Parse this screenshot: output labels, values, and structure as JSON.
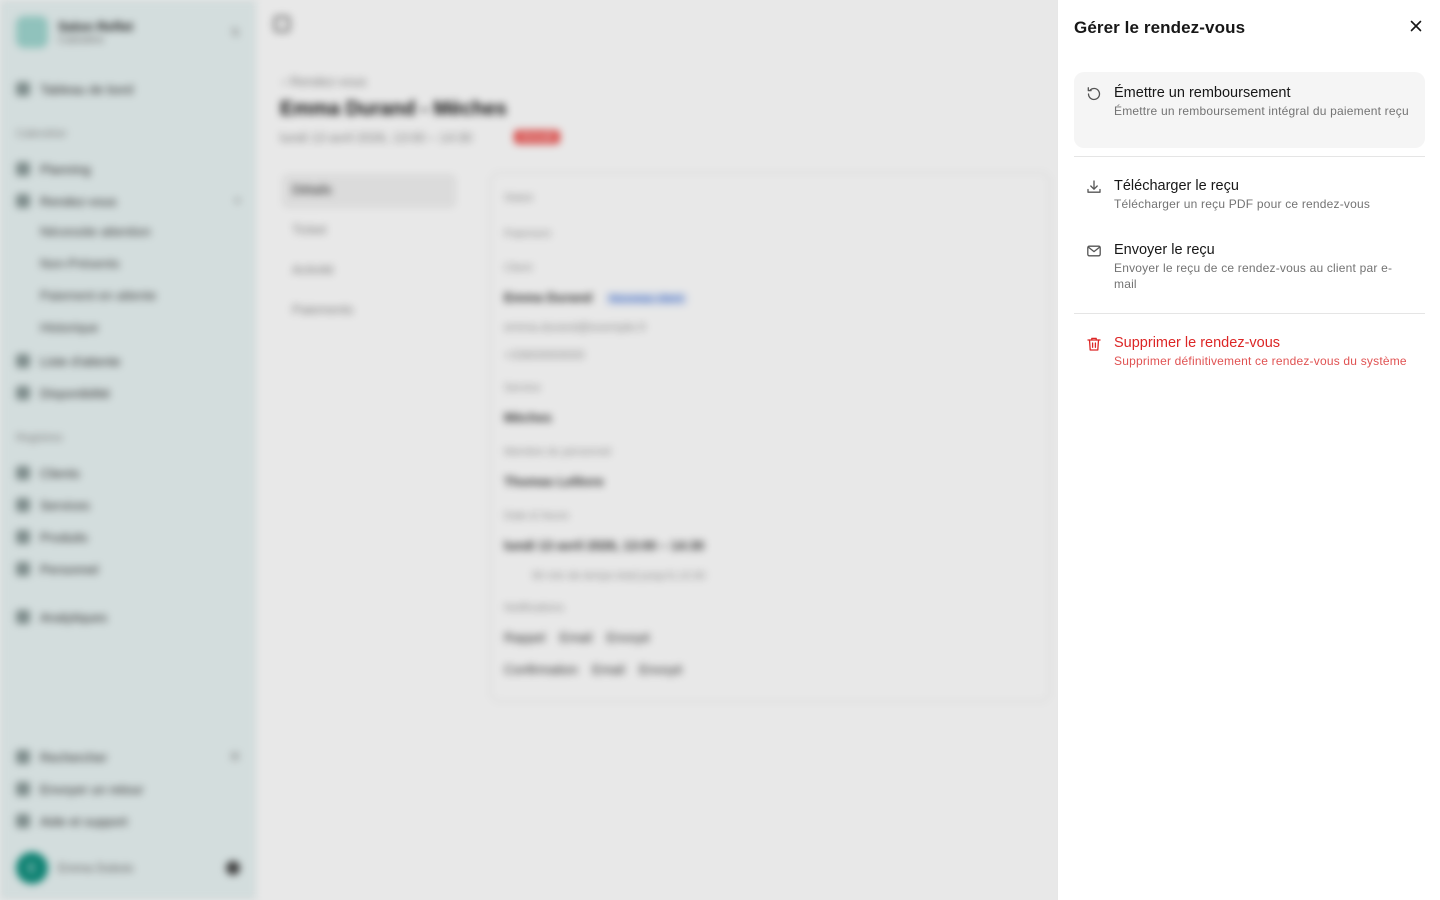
{
  "background": {
    "sidebar": {
      "business_name": "Salon Reflet",
      "business_role": "Caissière",
      "dashboard": "Tableau de bord",
      "group_calendar": "Calendrier",
      "planning": "Planning",
      "appointments": "Rendez-vous",
      "sub_items": [
        "Nécessite attention",
        "Non-Présents",
        "Paiement en attente",
        "Historique"
      ],
      "waitlist": "Liste d'attente",
      "availability": "Disponibilité",
      "group_admin": "Registres",
      "clients": "Clients",
      "services": "Services",
      "products": "Produits",
      "staff": "Personnel",
      "analytics": "Analytiques",
      "search": "Rechercher",
      "feedback": "Envoyer un retour",
      "help": "Aide et support",
      "avatar_initial": "E",
      "user_name": "Emma Dubois"
    },
    "main": {
      "back_link": "Rendez-vous",
      "title": "Emma Durand - Mèches",
      "datetime": "lundi 13 avril 2026, 13:00 – 14:30",
      "status_badge": "Annulé",
      "tabs": [
        "Détails",
        "Ticket",
        "Activité",
        "Paiements"
      ],
      "labels": {
        "status": "Statut",
        "payment": "Paiement",
        "client": "Client",
        "service": "Service",
        "staff": "Membre du personnel",
        "datetime": "Date & heure",
        "notifications": "Notifications"
      },
      "client_name": "Emma Durand",
      "client_tag": "Nouveau client",
      "client_email": "emma.durand@exemple.fr",
      "client_phone": "+33600000000",
      "service_name": "Mèches",
      "staff_name": "Thomas Lefèvre",
      "appt_datetime": "lundi 13 avril 2026, 13:00 – 14:30",
      "appt_note": "90 min de temps total jusqu'à 14:30",
      "notif_rows": [
        {
          "type": "Rappel",
          "channel": "Email",
          "state": "Envoyé"
        },
        {
          "type": "Confirmation",
          "channel": "Email",
          "state": "Envoyé"
        }
      ]
    }
  },
  "panel": {
    "title": "Gérer le rendez-vous",
    "close_icon": "close-icon",
    "actions": [
      {
        "icon": "refund-icon",
        "title": "Émettre un remboursement",
        "description": "Émettre un remboursement intégral du paiement reçu"
      },
      {
        "icon": "download-icon",
        "title": "Télécharger le reçu",
        "description": "Télécharger un reçu PDF pour ce rendez-vous"
      },
      {
        "icon": "mail-icon",
        "title": "Envoyer le reçu",
        "description": "Envoyer le reçu de ce rendez-vous au client par e-mail"
      },
      {
        "icon": "trash-icon",
        "title": "Supprimer le rendez-vous",
        "description": "Supprimer définitivement ce rendez-vous du système"
      }
    ],
    "colors": {
      "danger": "#dc2626",
      "highlight_bg": "#f5f5f5",
      "text": "#171717",
      "muted": "#737373"
    }
  }
}
